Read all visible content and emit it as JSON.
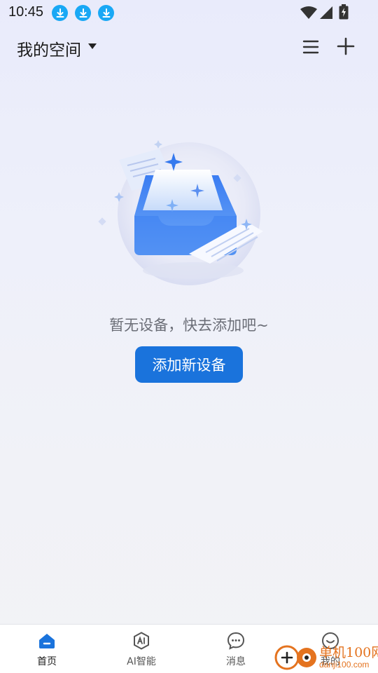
{
  "status_bar": {
    "time": "10:45",
    "icons": [
      "download-icon",
      "download-icon",
      "download-icon",
      "wifi-icon",
      "signal-icon",
      "battery-icon"
    ],
    "download_color": "#19a8f5"
  },
  "header": {
    "title": "我的空间",
    "icons": [
      "dropdown-caret-icon",
      "menu-icon",
      "plus-icon"
    ]
  },
  "empty_state": {
    "message": "暂无设备，快去添加吧~",
    "button_label": "添加新设备",
    "illustration": "empty-inbox-illustration"
  },
  "bottom_nav": {
    "items": [
      {
        "label": "首页",
        "icon": "home-icon",
        "active": true
      },
      {
        "label": "AI智能",
        "icon": "ai-hexagon-icon",
        "active": false
      },
      {
        "label": "消息",
        "icon": "message-bubble-icon",
        "active": false
      },
      {
        "label": "我的",
        "icon": "smiley-icon",
        "active": false
      }
    ]
  },
  "watermark": {
    "name": "单机100网",
    "url": "danji100.com"
  },
  "colors": {
    "accent": "#1a73dc",
    "home_active": "#1a73dc",
    "watermark": "#e4731f"
  }
}
